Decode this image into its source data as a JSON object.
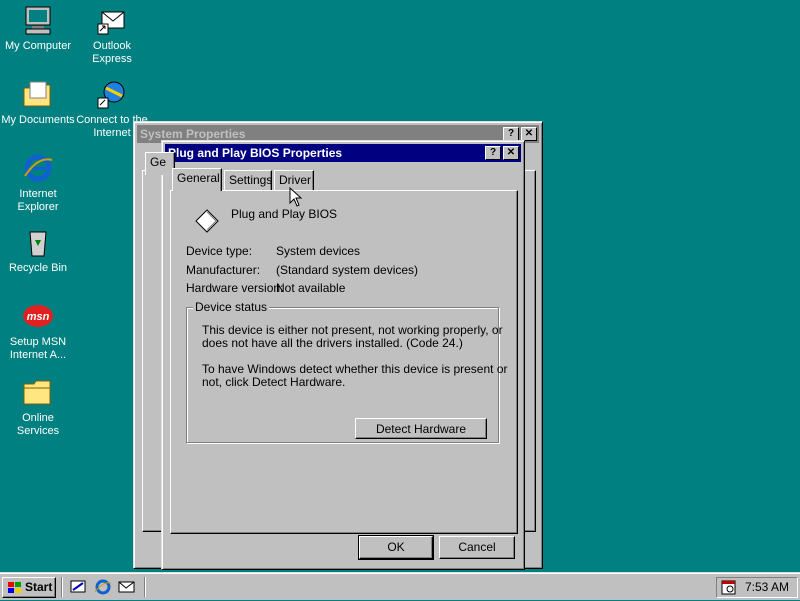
{
  "desktop": {
    "icons": [
      {
        "label": "My Computer",
        "icon": "my-computer-icon"
      },
      {
        "label": "Outlook Express",
        "icon": "outlook-express-icon"
      },
      {
        "label": "My Documents",
        "icon": "my-documents-icon"
      },
      {
        "label": "Connect to the Internet",
        "icon": "connect-internet-icon"
      },
      {
        "label": "Internet Explorer",
        "icon": "internet-explorer-icon"
      },
      {
        "label": "Recycle Bin",
        "icon": "recycle-bin-icon"
      },
      {
        "label": "Setup MSN Internet A...",
        "icon": "msn-icon"
      },
      {
        "label": "Online Services",
        "icon": "folder-icon"
      }
    ],
    "background_color": "#008080"
  },
  "system_properties": {
    "title": "System Properties",
    "tab_stub": "Ge",
    "help_button": "?",
    "close_button": "✕"
  },
  "dialog": {
    "title": "Plug and Play BIOS Properties",
    "help_button": "?",
    "close_button": "✕",
    "tabs": [
      "General",
      "Settings",
      "Driver"
    ],
    "selected_tab": "General",
    "device_name": "Plug and Play BIOS",
    "device_icon": "device-diamond-icon",
    "fields": [
      {
        "label": "Device type:",
        "value": "System devices"
      },
      {
        "label": "Manufacturer:",
        "value": "(Standard system devices)"
      },
      {
        "label": "Hardware version:",
        "value": "Not available"
      }
    ],
    "status_group_title": "Device status",
    "status_line1": "This device is either not present, not working properly, or",
    "status_line2": "does not have all the drivers installed.  (Code 24.)",
    "status_line3": "To have Windows detect whether this device is present or",
    "status_line4": "not, click Detect Hardware.",
    "detect_button": "Detect Hardware",
    "ok_button": "OK",
    "cancel_button": "Cancel"
  },
  "taskbar": {
    "start_label": "Start",
    "clock": "7:53 AM",
    "quick_launch": [
      "show-desktop-icon",
      "ie-quicklaunch-icon",
      "outlook-quicklaunch-icon"
    ],
    "tray_icon": "scheduler-icon"
  },
  "colors": {
    "titlebar_active": "#000080",
    "titlebar_inactive": "#808080",
    "face": "#c0c0c0"
  }
}
